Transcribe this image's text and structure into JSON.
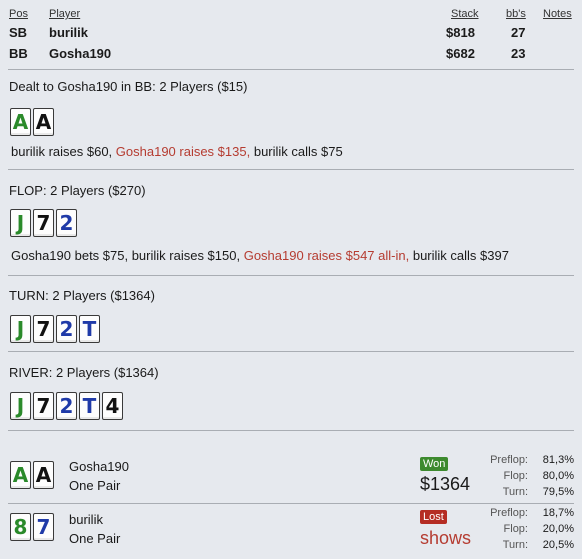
{
  "header": {
    "pos": "Pos",
    "player": "Player",
    "stack": "Stack",
    "bbs": "bb's",
    "notes": "Notes"
  },
  "players": [
    {
      "pos": "SB",
      "name": "burilik",
      "stack": "$818",
      "bbs": "27"
    },
    {
      "pos": "BB",
      "name": "Gosha190",
      "stack": "$682",
      "bbs": "23"
    }
  ],
  "preflop": {
    "title": "Dealt to Gosha190 in BB: 2 Players ($15)",
    "cards": [
      {
        "rank": "A",
        "color": "#2a8a2a"
      },
      {
        "rank": "A",
        "color": "#111111"
      }
    ],
    "actions": {
      "a1": "burilik raises $60,",
      "a2": "Gosha190 raises $135,",
      "a3": "burilik calls $75"
    }
  },
  "flop": {
    "title": "FLOP: 2 Players ($270)",
    "cards": [
      {
        "rank": "J",
        "color": "#2a8a2a"
      },
      {
        "rank": "7",
        "color": "#111111"
      },
      {
        "rank": "2",
        "color": "#1f3aa8"
      }
    ],
    "actions": {
      "a1": "Gosha190 bets $75, burilik raises $150,",
      "a2": "Gosha190 raises $547 all-in,",
      "a3": "burilik calls $397"
    }
  },
  "turn": {
    "title": "TURN: 2 Players ($1364)",
    "cards": [
      {
        "rank": "J",
        "color": "#2a8a2a"
      },
      {
        "rank": "7",
        "color": "#111111"
      },
      {
        "rank": "2",
        "color": "#1f3aa8"
      },
      {
        "rank": "T",
        "color": "#1f3aa8"
      }
    ]
  },
  "river": {
    "title": "RIVER: 2 Players ($1364)",
    "cards": [
      {
        "rank": "J",
        "color": "#2a8a2a"
      },
      {
        "rank": "7",
        "color": "#111111"
      },
      {
        "rank": "2",
        "color": "#1f3aa8"
      },
      {
        "rank": "T",
        "color": "#1f3aa8"
      },
      {
        "rank": "4",
        "color": "#111111"
      }
    ]
  },
  "results": [
    {
      "name": "Gosha190",
      "hand": "One Pair",
      "badge": "Won",
      "badge_color": "#3d8a2e",
      "amount": "$1364",
      "amount_color": "#1a1a1a",
      "cards": [
        {
          "rank": "A",
          "color": "#2a8a2a"
        },
        {
          "rank": "A",
          "color": "#111111"
        }
      ],
      "stats": {
        "preflop_label": "Preflop:",
        "preflop": "81,3%",
        "flop_label": "Flop:",
        "flop": "80,0%",
        "turn_label": "Turn:",
        "turn": "79,5%"
      }
    },
    {
      "name": "burilik",
      "hand": "One Pair",
      "badge": "Lost",
      "badge_color": "#b52d24",
      "amount": "shows",
      "amount_color": "#b53c31",
      "cards": [
        {
          "rank": "8",
          "color": "#2a8a2a"
        },
        {
          "rank": "7",
          "color": "#1f3aa8"
        }
      ],
      "stats": {
        "preflop_label": "Preflop:",
        "preflop": "18,7%",
        "flop_label": "Flop:",
        "flop": "20,0%",
        "turn_label": "Turn:",
        "turn": "20,5%"
      }
    }
  ]
}
